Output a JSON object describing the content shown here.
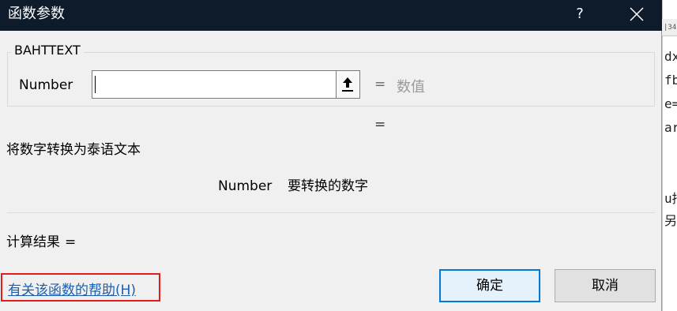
{
  "dialog": {
    "title": "函数参数",
    "help_glyph": "?",
    "function_name": "BAHTTEXT",
    "argument": {
      "label": "Number",
      "value": "",
      "equals": "=",
      "type_hint": "数值"
    },
    "formula_equals": "=",
    "description": "将数字转换为泰语文本",
    "arg_description": {
      "name": "Number",
      "text": "要转换的数字"
    },
    "result": {
      "label": "计算结果",
      "equals": "="
    },
    "help_link": "有关该函数的帮助(H)",
    "ok_label": "确定",
    "cancel_label": "取消"
  },
  "background_app": {
    "strip_text": "|34",
    "code_fragments": [
      "dx",
      "fb",
      "e=",
      "ar",
      "u招",
      "另"
    ]
  },
  "colors": {
    "titlebar": "#0d1b2a",
    "dialog_bg": "#f0f0f0",
    "link": "#1a5fb4",
    "highlight_box": "#e31b1b",
    "ok_border": "#0078d7"
  },
  "icons": {
    "close": "close-icon",
    "collapse": "collapse-arrow-icon"
  }
}
